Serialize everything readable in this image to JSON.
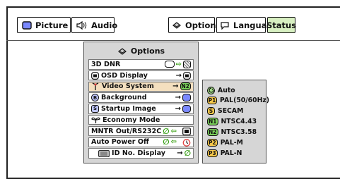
{
  "colors": {
    "status_active_bg": "#d8f0c2",
    "selected_row_bg": "#f4dfbf",
    "badge_green": "#7ad05a",
    "badge_yellow": "#f7c94b",
    "menu_bg": "#d6d6d6"
  },
  "tabs": {
    "picture": {
      "label": "Picture",
      "icon": "screen-icon"
    },
    "audio": {
      "label": "Audio",
      "icon": "speaker-icon"
    },
    "options": {
      "label": "Options",
      "icon": "options-icon"
    },
    "language": {
      "label": "Language",
      "icon": "speech-bubble-icon"
    },
    "status": {
      "label": "Status",
      "active": true
    }
  },
  "menu": {
    "title": "Options",
    "items": [
      {
        "label": "3D DNR",
        "value_icon": "toggle-icon"
      },
      {
        "label": "OSD Display",
        "value_icon": "osd-icon"
      },
      {
        "label": "Video System",
        "value": "N2",
        "selected": true
      },
      {
        "label": "Background"
      },
      {
        "label": "Startup Image"
      },
      {
        "label": "Economy Mode"
      },
      {
        "label": "MNTR Out/RS232C"
      },
      {
        "label": "Auto Power Off"
      },
      {
        "label": "ID No. Display"
      }
    ]
  },
  "submenu": {
    "items": [
      {
        "badge": "",
        "label": "Auto"
      },
      {
        "badge": "P1",
        "label": "PAL(50/60Hz)"
      },
      {
        "badge": "S",
        "label": "SECAM"
      },
      {
        "badge": "N1",
        "label": "NTSC4.43"
      },
      {
        "badge": "N2",
        "label": "NTSC3.58"
      },
      {
        "badge": "P2",
        "label": "PAL-M"
      },
      {
        "badge": "P3",
        "label": "PAL-N"
      }
    ]
  },
  "glyphs": {
    "arrow_right": "→",
    "arrow_double": "⇨",
    "arrow_left": "⇦",
    "leaf": "∅"
  }
}
